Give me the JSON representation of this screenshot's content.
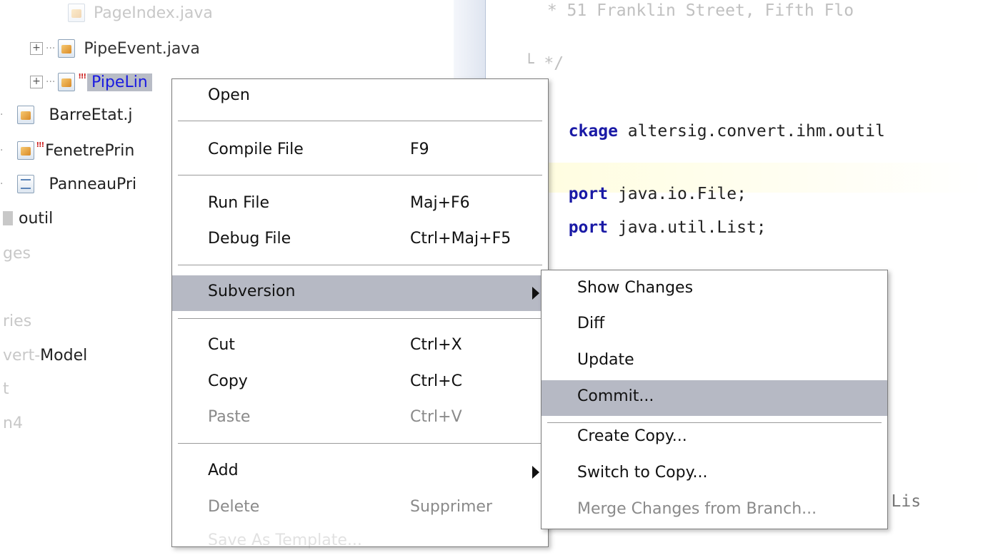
{
  "tree": {
    "items": [
      {
        "label": "PageIndex.java",
        "faded": true
      },
      {
        "label": "PipeEvent.java"
      },
      {
        "label": "PipeLin",
        "selected": true,
        "badge": "!!!"
      },
      {
        "label": "BarreEtat.j"
      },
      {
        "label": "FenetrePrin",
        "badge": "!!!"
      },
      {
        "label": "PanneauPri"
      },
      {
        "label": "outil"
      },
      {
        "label": "ges",
        "faded": true
      },
      {
        "label": "ries",
        "faded": true
      },
      {
        "label_faded": "vert-",
        "label": "Model"
      },
      {
        "label": "t",
        "faded": true
      },
      {
        "label": "n4",
        "faded": true
      }
    ]
  },
  "editor": {
    "lines": [
      {
        "text": " * 51 Franklin Street, Fifth Flo",
        "comment": true
      },
      {
        "text": " */",
        "comment": true
      },
      {
        "kw": "ckage",
        "text": " altersig.convert.ihm.outil"
      },
      {
        "kw": "port",
        "text": " java.io.File;"
      },
      {
        "kw": "port",
        "text": " java.util.List;"
      },
      {
        "text": "t( Lis"
      }
    ]
  },
  "context_menu": {
    "items": [
      {
        "label": "Open",
        "shortcut": ""
      },
      {
        "label": "Compile File",
        "shortcut": "F9"
      },
      {
        "label": "Run File",
        "shortcut": "Maj+F6"
      },
      {
        "label": "Debug File",
        "shortcut": "Ctrl+Maj+F5"
      },
      {
        "label": "Subversion",
        "shortcut": ""
      },
      {
        "label": "Cut",
        "shortcut": "Ctrl+X"
      },
      {
        "label": "Copy",
        "shortcut": "Ctrl+C"
      },
      {
        "label": "Paste",
        "shortcut": "Ctrl+V"
      },
      {
        "label": "Add",
        "shortcut": ""
      },
      {
        "label": "Delete",
        "shortcut": "Supprimer"
      },
      {
        "label": "Save As Template...",
        "shortcut": ""
      }
    ]
  },
  "subversion_menu": {
    "items": [
      {
        "label": "Show Changes"
      },
      {
        "label": "Diff"
      },
      {
        "label": "Update"
      },
      {
        "label": "Commit..."
      },
      {
        "label": "Create Copy..."
      },
      {
        "label": "Switch to Copy..."
      },
      {
        "label": "Merge Changes from Branch..."
      }
    ]
  },
  "colors": {
    "menu_hover": "#b6b9c4",
    "selection_text": "#1a1ae0",
    "keyword": "#1a1aa6"
  }
}
